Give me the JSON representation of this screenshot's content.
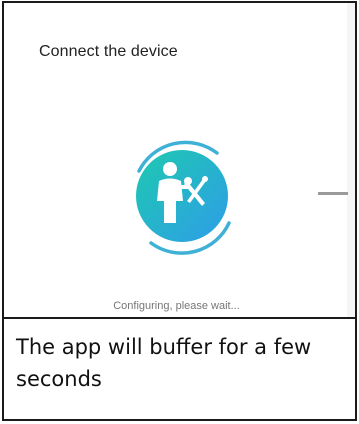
{
  "screen": {
    "title": "Connect the device",
    "status": "Configuring, please wait..."
  },
  "spinner": {
    "icon": "technician-with-wrench-icon",
    "gradient_start": "#1ec9b0",
    "gradient_end": "#2e9de8",
    "arc_color": "#3fb0d6"
  },
  "caption": {
    "text": "The app will buffer for a few seconds"
  }
}
